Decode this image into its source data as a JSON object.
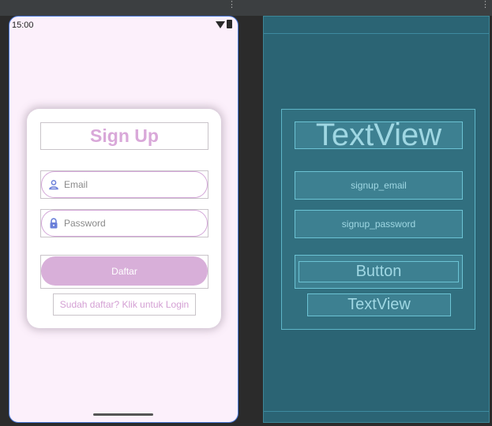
{
  "design": {
    "status_time": "15:00",
    "title": "Sign Up",
    "email_placeholder": "Email",
    "password_placeholder": "Password",
    "signup_button": "Daftar",
    "login_link": "Sudah daftar? Klik untuk Login"
  },
  "blueprint": {
    "title_view": "TextView",
    "email_id": "signup_email",
    "password_id": "signup_password",
    "button_label": "Button",
    "link_view": "TextView"
  },
  "colors": {
    "accent": "#d8afd9",
    "screen_bg": "#fcf0fb",
    "blueprint_bg": "#2b6474"
  },
  "icons": {
    "email": "person-icon",
    "password": "lock-icon",
    "wifi": "wifi-icon",
    "battery": "battery-icon"
  }
}
